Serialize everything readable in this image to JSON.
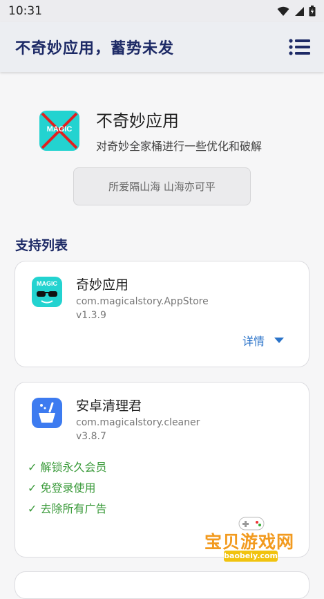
{
  "status_bar": {
    "time": "10:31"
  },
  "appbar": {
    "title": "不奇妙应用，蓄势未发"
  },
  "hero": {
    "name": "不奇妙应用",
    "description": "对奇妙全家桶进行一些优化和破解",
    "icon_text": "MAGIC"
  },
  "motto": "所爱隔山海 山海亦可平",
  "section_title": "支持列表",
  "apps": [
    {
      "name": "奇妙应用",
      "package": "com.magicalstory.AppStore",
      "version": "v1.3.9",
      "details_label": "详情",
      "icon_text": "MAGIC",
      "icon": "magic-sunglasses-icon"
    },
    {
      "name": "安卓清理君",
      "package": "com.magicalstory.cleaner",
      "version": "v3.8.7",
      "icon": "broom-cleaner-icon",
      "features": [
        "✓ 解锁永久会员",
        "✓ 免登录使用",
        "✓ 去除所有广告"
      ]
    }
  ],
  "watermark": {
    "text": "宝贝游戏网",
    "url": "baobeiy.com"
  },
  "colors": {
    "accent": "#1d2a66",
    "link": "#2a73c9",
    "success": "#3a9a3a",
    "icon_teal": "#23d3d0",
    "icon_blue": "#3d7bf0"
  }
}
